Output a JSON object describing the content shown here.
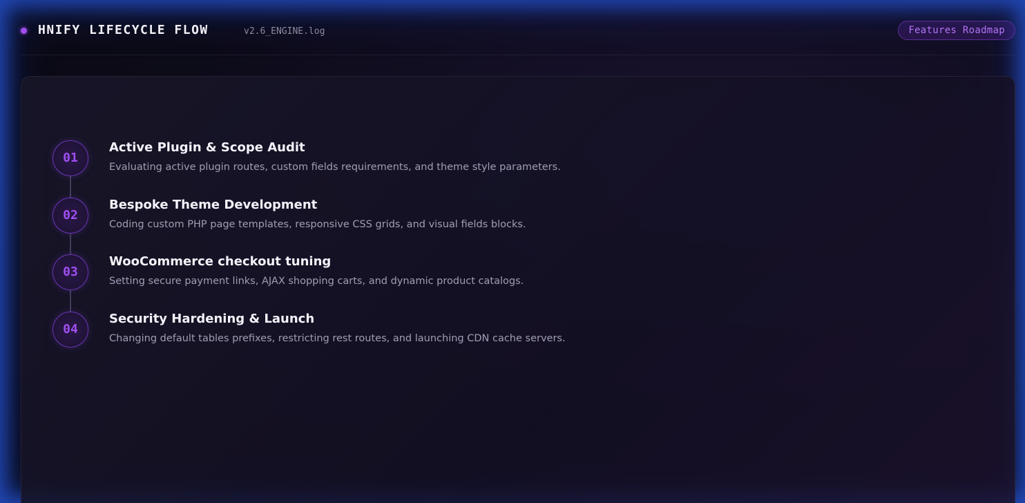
{
  "header": {
    "title": "HNIFY LIFECYCLE FLOW",
    "version": "v2.6_ENGINE.log",
    "roadmap_button": "Features Roadmap"
  },
  "colors": {
    "accent": "#a24df0",
    "glow": "#285adc",
    "background": "#0c0b18"
  },
  "steps": [
    {
      "number": "01",
      "title": "Active Plugin & Scope Audit",
      "description": "Evaluating active plugin routes, custom fields requirements, and theme style parameters."
    },
    {
      "number": "02",
      "title": "Bespoke Theme Development",
      "description": "Coding custom PHP page templates, responsive CSS grids, and visual fields blocks."
    },
    {
      "number": "03",
      "title": "WooCommerce checkout tuning",
      "description": "Setting secure payment links, AJAX shopping carts, and dynamic product catalogs."
    },
    {
      "number": "04",
      "title": "Security Hardening & Launch",
      "description": "Changing default tables prefixes, restricting rest routes, and launching CDN cache servers."
    }
  ]
}
